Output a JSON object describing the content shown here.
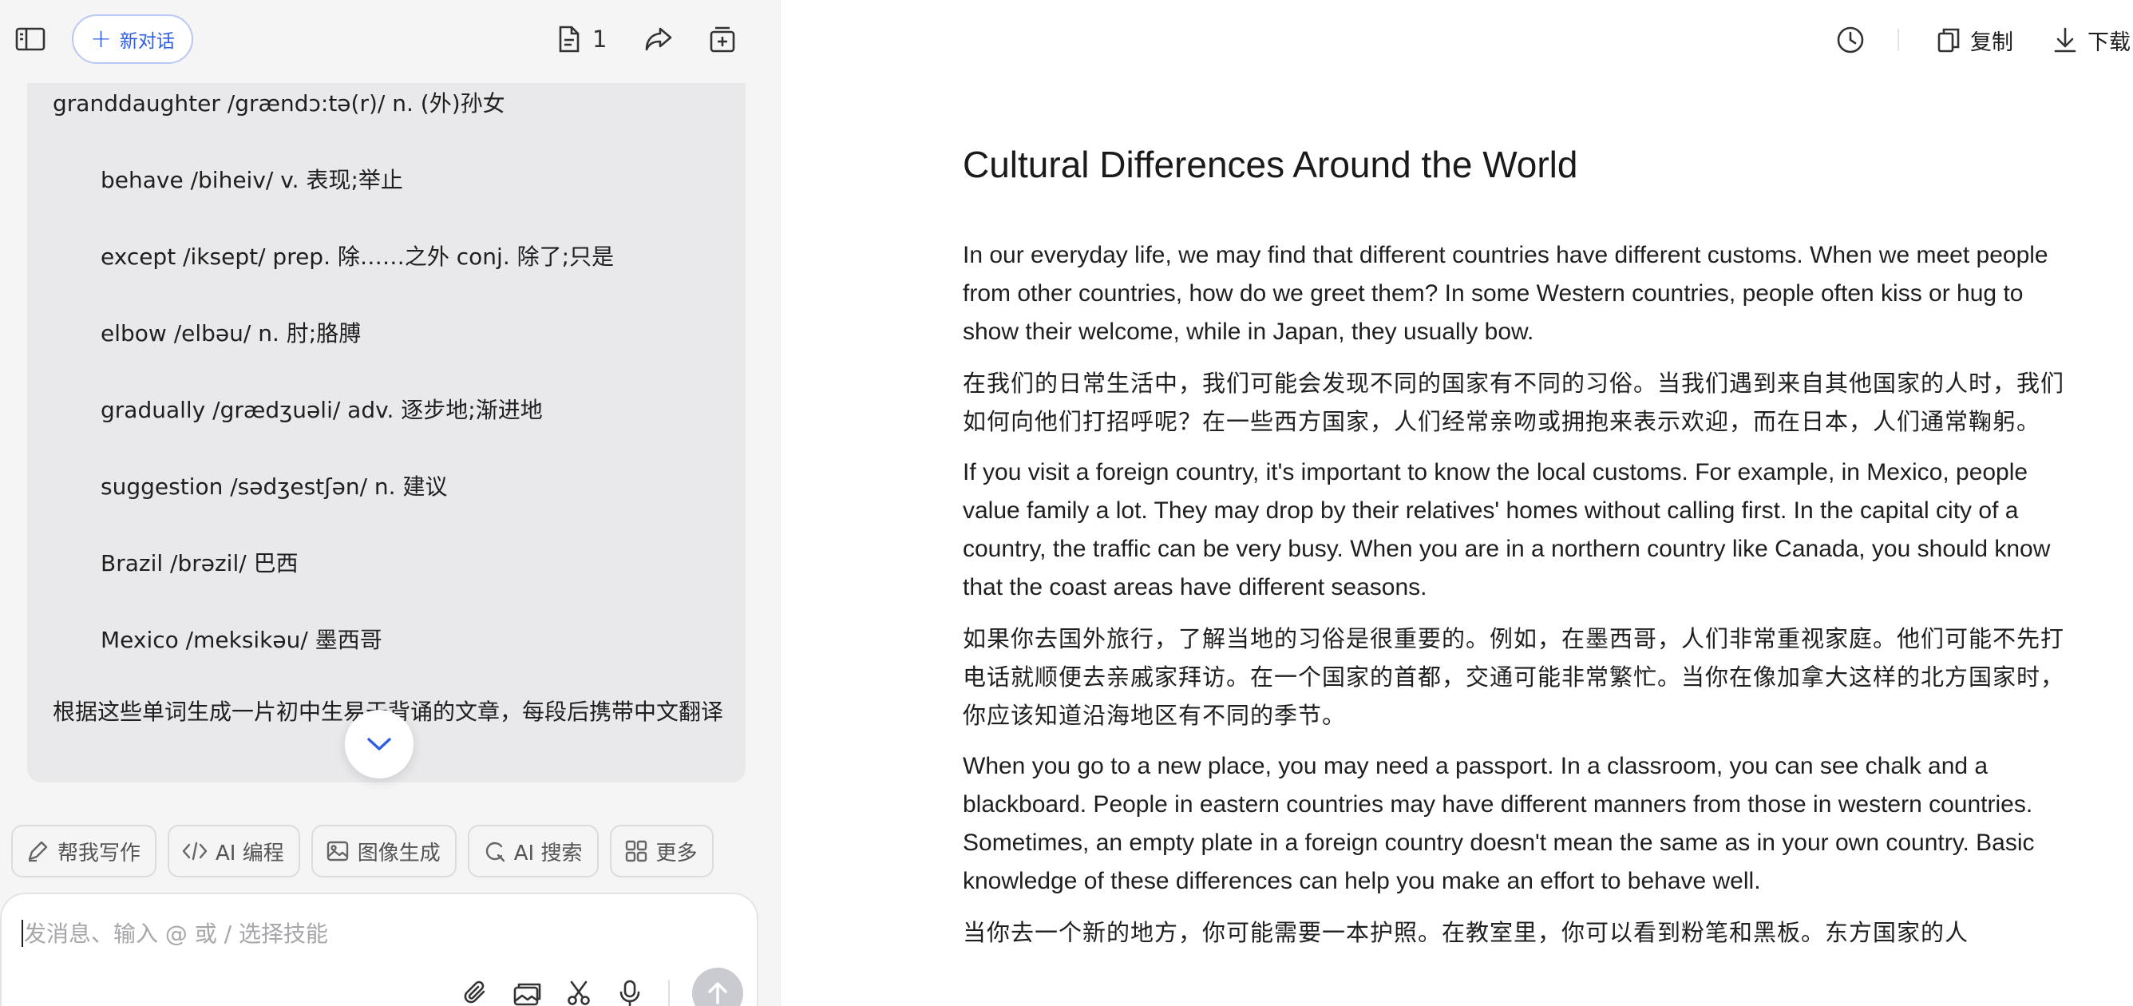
{
  "header": {
    "new_chat_label": "新对话",
    "doc_count": "1"
  },
  "chat": {
    "vocab_first": "granddaughter /grændɔ:tə(r)/ n. (外)孙女",
    "vocab": [
      "behave /biheiv/ v. 表现;举止",
      "except /iksept/ prep. 除……之外 conj. 除了;只是",
      "elbow /elbəu/ n. 肘;胳膊",
      "gradually /grædʒuəli/ adv. 逐步地;渐进地",
      "suggestion /sədʒestʃən/ n. 建议",
      "Brazil /brəzil/ 巴西",
      "Mexico /meksikəu/ 墨西哥"
    ],
    "prompt": "根据这些单词生成一片初中生易于背诵的文章，每段后携带中文翻译"
  },
  "skills": [
    {
      "label": "帮我写作",
      "icon": "pen-icon"
    },
    {
      "label": "AI 编程",
      "icon": "code-icon"
    },
    {
      "label": "图像生成",
      "icon": "image-icon"
    },
    {
      "label": "AI 搜索",
      "icon": "search-icon"
    },
    {
      "label": "更多",
      "icon": "grid-icon"
    }
  ],
  "composer": {
    "placeholder": "发消息、输入 @ 或 / 选择技能"
  },
  "doc_toolbar": {
    "copy_label": "复制",
    "download_label": "下载"
  },
  "article": {
    "title": "Cultural Differences Around the World",
    "paragraphs": [
      {
        "lang": "en",
        "text": "In our everyday life, we may find that different countries have different customs. When we meet people from other countries, how do we greet them? In some Western countries, people often kiss or hug to show their welcome, while in Japan, they usually bow."
      },
      {
        "lang": "zh",
        "text": "在我们的日常生活中，我们可能会发现不同的国家有不同的习俗。当我们遇到来自其他国家的人时，我们如何向他们打招呼呢？在一些西方国家，人们经常亲吻或拥抱来表示欢迎，而在日本，人们通常鞠躬。"
      },
      {
        "lang": "en",
        "text": "If you visit a foreign country, it's important to know the local customs. For example, in Mexico, people value family a lot. They may drop by their relatives' homes without calling first. In the capital city of a country, the traffic can be very busy. When you are in a northern country like Canada, you should know that the coast areas have different seasons."
      },
      {
        "lang": "zh",
        "text": "如果你去国外旅行，了解当地的习俗是很重要的。例如，在墨西哥，人们非常重视家庭。他们可能不先打电话就顺便去亲戚家拜访。在一个国家的首都，交通可能非常繁忙。当你在像加拿大这样的北方国家时，你应该知道沿海地区有不同的季节。"
      },
      {
        "lang": "en",
        "text": "When you go to a new place, you may need a passport. In a classroom, you can see chalk and a blackboard. People in eastern countries may have different manners from those in western countries. Sometimes, an empty plate in a foreign country doesn't mean the same as in your own country. Basic knowledge of these differences can help you make an effort to behave well."
      },
      {
        "lang": "zh",
        "text": "当你去一个新的地方，你可能需要一本护照。在教室里，你可以看到粉笔和黑板。东方国家的人"
      }
    ]
  }
}
